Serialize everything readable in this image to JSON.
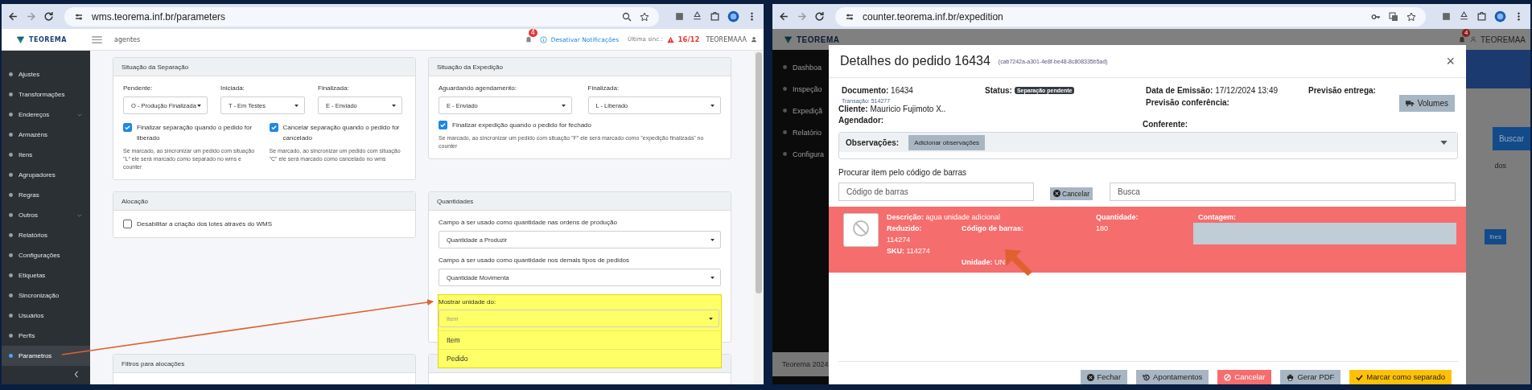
{
  "left_window": {
    "url": "wms.teorema.inf.br/parameters",
    "header": {
      "logo": "TEOREMA",
      "section": "agentes",
      "notification_count": "4",
      "notifications_link": "Desativar Notificações",
      "sync_label": "Última sinc.:",
      "sync_date": "16/12",
      "user": "TEOREMAAA"
    },
    "sidebar": {
      "items": [
        {
          "label": "Ajustes",
          "expandable": false,
          "selected": false
        },
        {
          "label": "Transformações",
          "expandable": false,
          "selected": false
        },
        {
          "label": "Endereços",
          "expandable": true,
          "selected": false
        },
        {
          "label": "Armazéns",
          "expandable": false,
          "selected": false
        },
        {
          "label": "Itens",
          "expandable": false,
          "selected": false
        },
        {
          "label": "Agrupadores",
          "expandable": false,
          "selected": false
        },
        {
          "label": "Regras",
          "expandable": false,
          "selected": false
        },
        {
          "label": "Outros",
          "expandable": true,
          "selected": false
        },
        {
          "label": "Relatórios",
          "expandable": false,
          "selected": false
        },
        {
          "label": "Configurações",
          "expandable": false,
          "selected": false
        },
        {
          "label": "Etiquetas",
          "expandable": false,
          "selected": false
        },
        {
          "label": "Sincronização",
          "expandable": false,
          "selected": false
        },
        {
          "label": "Usuários",
          "expandable": false,
          "selected": false
        },
        {
          "label": "Perfis",
          "expandable": false,
          "selected": false
        },
        {
          "label": "Parametros",
          "expandable": false,
          "selected": true
        }
      ]
    },
    "separacao": {
      "title": "Situação da Separação",
      "selects": [
        {
          "label": "Pendente:",
          "value": "O - Produção Finalizada"
        },
        {
          "label": "Iniciada:",
          "value": "T - Em Testes"
        },
        {
          "label": "Finalizada:",
          "value": "E - Enviado"
        }
      ],
      "checks": [
        {
          "label": "Finalizar separação quando o pedido for liberado",
          "checked": true,
          "help": "Se marcado, ao sincronizar um pedido com situação \"L\" ele será marcado como separado no wms e counter"
        },
        {
          "label": "Cancelar separação quando o pedido for cancelado",
          "checked": true,
          "help": "Se marcado, ao sincronizar um pedido com situação \"C\" ele será marcado como cancelado no wms"
        }
      ]
    },
    "expedicao": {
      "title": "Situação da Expedição",
      "selects": [
        {
          "label": "Aguardando agendamento:",
          "value": "E - Enviado"
        },
        {
          "label": "Finalizada:",
          "value": "L - Liberado"
        }
      ],
      "checks": [
        {
          "label": "Finalizar expedição quando o pedido for fechado",
          "checked": true,
          "help": "Se marcado, ao sincronizar um pedido com situação \"F\" ele será marcado como \"expedição finalizada\" no counter"
        }
      ]
    },
    "alocacao": {
      "title": "Alocação",
      "checks": [
        {
          "label": "Desabilitar a criação dos lotes através do WMS",
          "checked": false
        }
      ]
    },
    "quantidades": {
      "title": "Quantidades",
      "fields": [
        {
          "label": "Campo à ser usado como quantidade nas ordens de produção",
          "value": "Quantidade a Produzir"
        },
        {
          "label": "Campo à ser usado como quantidade nos demais tipos de pedidos",
          "value": "Quantidade Movimenta"
        }
      ],
      "unit_field": {
        "label": "Mostrar unidade do:",
        "placeholder": "Item",
        "expanded": true,
        "options": [
          {
            "label": "Item",
            "selected": false
          },
          {
            "label": "Pedido",
            "selected": false
          }
        ]
      }
    },
    "filtros": {
      "title": "Filtros para alocações"
    }
  },
  "right_window": {
    "url": "counter.teorema.inf.br/expedition",
    "background": {
      "logo": "TEOREMA",
      "notification_count": "4",
      "user": "TEOREMAA",
      "sidebar": [
        "Dashboa",
        "Inspeção",
        "Expediçã",
        "Relatório",
        "Configura"
      ],
      "search_button": "Buscar",
      "column_text": "dos",
      "details_button": "lhes",
      "footer": "Teorema 2024"
    },
    "modal": {
      "title": "Detalhes do pedido 16434",
      "order_id": "(cab7242a-a301-4e8f-be48-8c808335b5ad)",
      "close": "×",
      "document": "**Documento:** 16434",
      "transaction": "Transação: 514277",
      "status_label": "Status:",
      "status_badge": "Separação pendente",
      "issue_date": "**Data de Emissão:** 17/12/2024 13:49",
      "delivery_forecast": "Previsão entrega:",
      "check_forecast": "Previsão conferência:",
      "client": "**Cliente:** Mauricio Fujimoto X..",
      "scheduler": "Agendador:",
      "checker": "Conferente:",
      "volumes_button": "Volumes",
      "observations_label": "Observações:",
      "observations_button": "Adicionar observações",
      "search_label": "Procurar item pelo código de barras",
      "barcode_placeholder": "Código de barras",
      "cancel_search": "Cancelar",
      "search_placeholder": "Busca",
      "items": [
        {
          "description": "**Descrição:** agua unidade adicional",
          "reduced_label": "Reduzido:",
          "reduced": "114274",
          "sku": "**SKU:** 114274",
          "barcode_label": "Código de barras:",
          "unit": "**Unidade:** UN",
          "quantity_label": "Quantidade:",
          "quantity": "180",
          "count_label": "Contagem:"
        }
      ],
      "footer_buttons": [
        {
          "label": "Fechar",
          "kind": "close"
        },
        {
          "label": "Apontamentos",
          "kind": "history"
        },
        {
          "label": "Cancelar",
          "kind": "cancel"
        },
        {
          "label": "Gerar PDF",
          "kind": "print"
        },
        {
          "label": "Marcar como separado",
          "kind": "confirm"
        }
      ]
    }
  }
}
